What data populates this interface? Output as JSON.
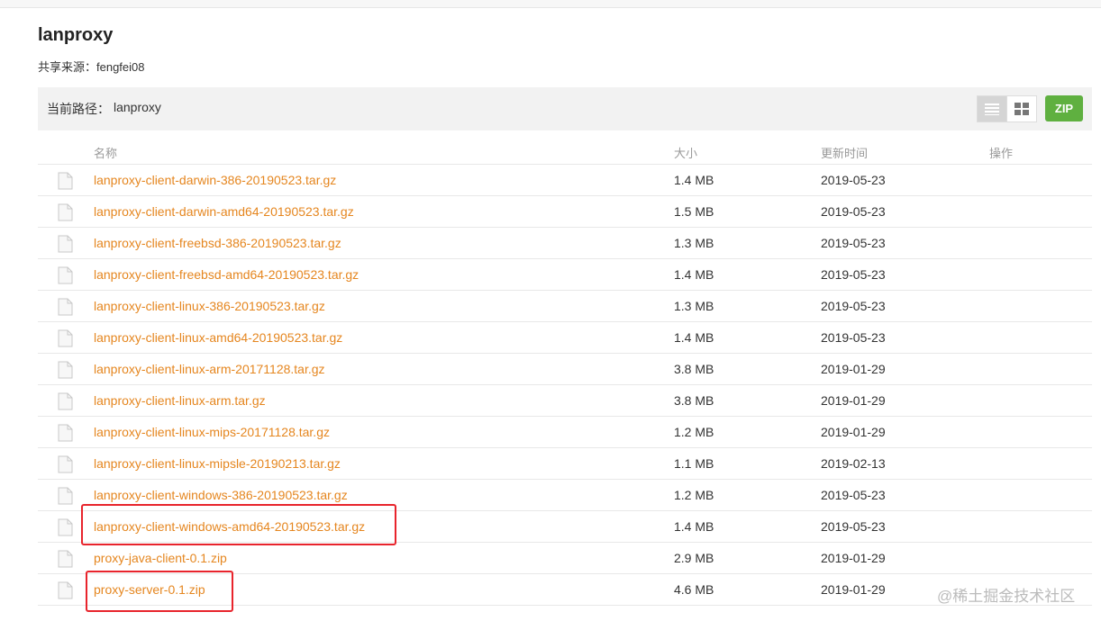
{
  "title": "lanproxy",
  "source": "共享来源：fengfei08",
  "path": {
    "label": "当前路径：",
    "value": "lanproxy"
  },
  "toolbar": {
    "zip_label": "ZIP"
  },
  "columns": {
    "name": "名称",
    "size": "大小",
    "updated": "更新时间",
    "actions": "操作"
  },
  "files": [
    {
      "name": "lanproxy-client-darwin-386-20190523.tar.gz",
      "size": "1.4 MB",
      "date": "2019-05-23"
    },
    {
      "name": "lanproxy-client-darwin-amd64-20190523.tar.gz",
      "size": "1.5 MB",
      "date": "2019-05-23"
    },
    {
      "name": "lanproxy-client-freebsd-386-20190523.tar.gz",
      "size": "1.3 MB",
      "date": "2019-05-23"
    },
    {
      "name": "lanproxy-client-freebsd-amd64-20190523.tar.gz",
      "size": "1.4 MB",
      "date": "2019-05-23"
    },
    {
      "name": "lanproxy-client-linux-386-20190523.tar.gz",
      "size": "1.3 MB",
      "date": "2019-05-23"
    },
    {
      "name": "lanproxy-client-linux-amd64-20190523.tar.gz",
      "size": "1.4 MB",
      "date": "2019-05-23"
    },
    {
      "name": "lanproxy-client-linux-arm-20171128.tar.gz",
      "size": "3.8 MB",
      "date": "2019-01-29"
    },
    {
      "name": "lanproxy-client-linux-arm.tar.gz",
      "size": "3.8 MB",
      "date": "2019-01-29"
    },
    {
      "name": "lanproxy-client-linux-mips-20171128.tar.gz",
      "size": "1.2 MB",
      "date": "2019-01-29"
    },
    {
      "name": "lanproxy-client-linux-mipsle-20190213.tar.gz",
      "size": "1.1 MB",
      "date": "2019-02-13"
    },
    {
      "name": "lanproxy-client-windows-386-20190523.tar.gz",
      "size": "1.2 MB",
      "date": "2019-05-23"
    },
    {
      "name": "lanproxy-client-windows-amd64-20190523.tar.gz",
      "size": "1.4 MB",
      "date": "2019-05-23"
    },
    {
      "name": "proxy-java-client-0.1.zip",
      "size": "2.9 MB",
      "date": "2019-01-29"
    },
    {
      "name": "proxy-server-0.1.zip",
      "size": "4.6 MB",
      "date": "2019-01-29"
    }
  ],
  "watermark": "@稀土掘金技术社区"
}
